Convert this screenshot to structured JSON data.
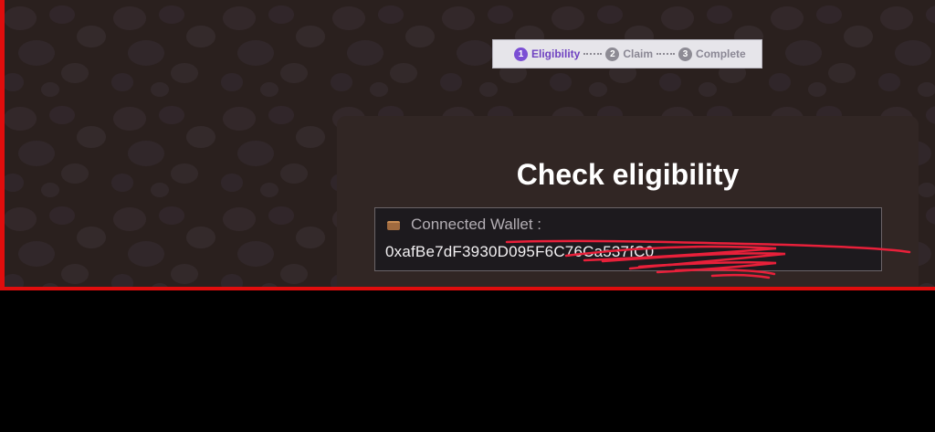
{
  "stepper": {
    "steps": [
      {
        "number": "1",
        "label": "Eligibility",
        "state": "active"
      },
      {
        "number": "2",
        "label": "Claim",
        "state": "inactive"
      },
      {
        "number": "3",
        "label": "Complete",
        "state": "inactive"
      }
    ]
  },
  "card": {
    "title": "Check eligibility",
    "wallet": {
      "icon": "wallet-icon",
      "label": "Connected Wallet :",
      "address": "0xafBe7dF3930D095F6C76Ca537fC0"
    }
  },
  "colors": {
    "active_step": "#7b4fd4",
    "background": "#2a201e",
    "card": "#312624",
    "frame_border": "#e00d0d",
    "redaction": "#e8203a"
  }
}
